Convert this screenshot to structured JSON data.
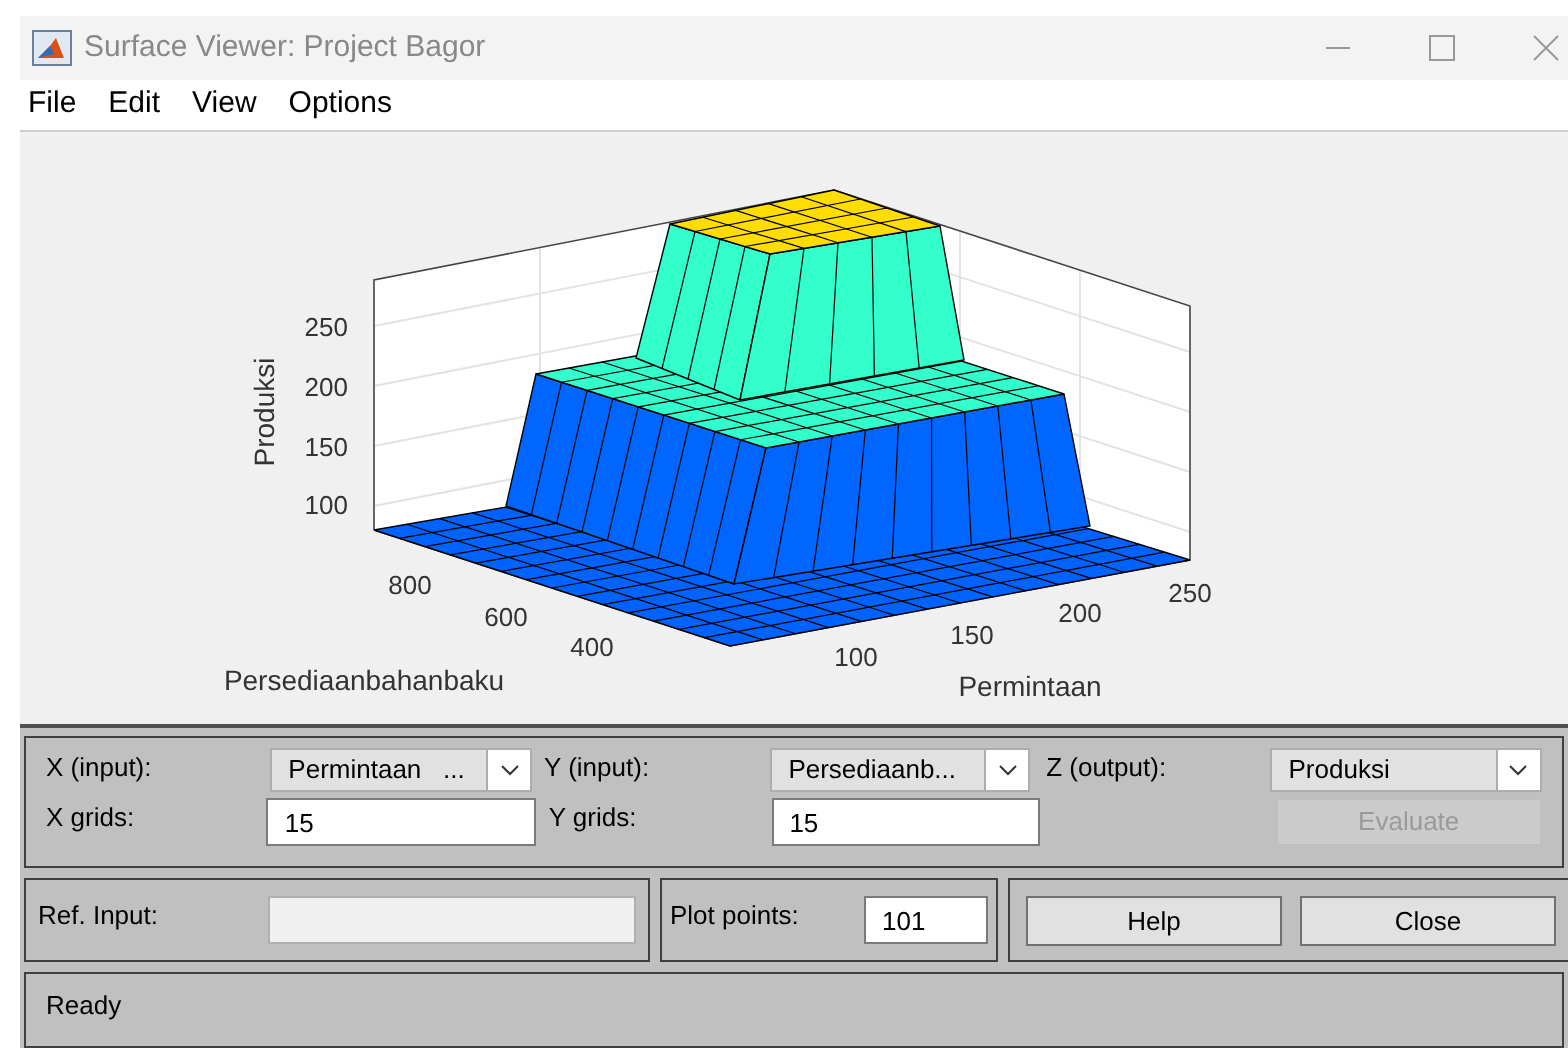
{
  "window": {
    "title": "Surface Viewer: Project Bagor"
  },
  "menu": [
    "File",
    "Edit",
    "View",
    "Options"
  ],
  "plot": {
    "zlabel": "Produksi",
    "xlabel": "Permintaan",
    "ylabel": "Persediaanbahanbaku",
    "zticks": [
      "250",
      "200",
      "150",
      "100"
    ],
    "xticks": [
      "100",
      "150",
      "200",
      "250"
    ],
    "yticks": [
      "800",
      "600",
      "400"
    ]
  },
  "controls": {
    "x_input": {
      "label": "X (input):",
      "value": "Permintaan   ..."
    },
    "y_input": {
      "label": "Y (input):",
      "value": "Persediaanb..."
    },
    "z_output": {
      "label": "Z (output):",
      "value": "Produksi"
    },
    "x_grids": {
      "label": "X grids:",
      "value": "15"
    },
    "y_grids": {
      "label": "Y grids:",
      "value": "15"
    },
    "evaluate": {
      "label": "Evaluate",
      "disabled": true
    },
    "ref_input": {
      "label": "Ref. Input:",
      "disabled": true
    },
    "plot_points": {
      "label": "Plot points:",
      "value": "101"
    },
    "buttons": [
      "Help",
      "Close"
    ]
  },
  "status": "Ready"
}
